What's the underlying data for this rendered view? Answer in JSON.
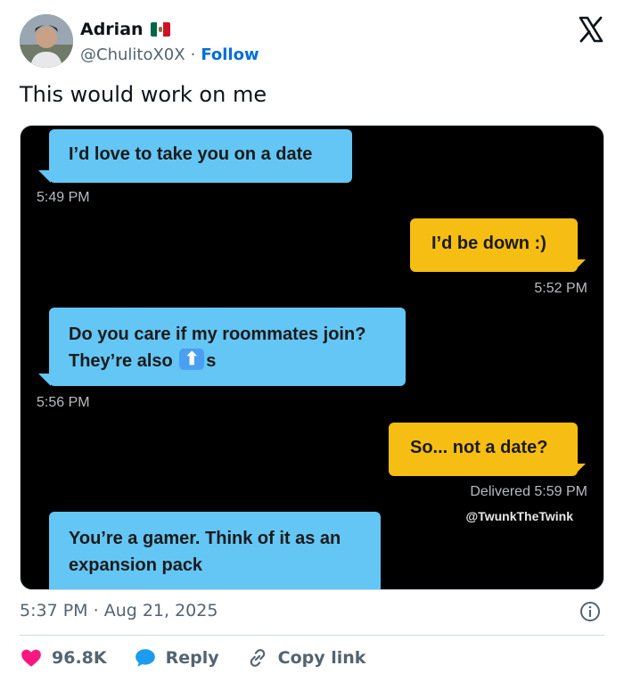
{
  "author": {
    "name": "Adrian",
    "handle": "@ChulitoX0X",
    "follow_label": "Follow",
    "separator": "·",
    "flag_colors": [
      "#006847",
      "#ffffff",
      "#ce1126"
    ]
  },
  "tweet": {
    "text": "This would work on me",
    "time": "5:37 PM",
    "date": "Aug 21, 2025",
    "meta_separator": "·"
  },
  "conversation": {
    "messages": [
      {
        "side": "in",
        "text": "I’d love to take you on a date",
        "stamp": "5:49 PM"
      },
      {
        "side": "out",
        "text": "I’d be down :)",
        "stamp": "5:52 PM"
      },
      {
        "side": "in",
        "line1": "Do you care if my roommates join?",
        "line2_prefix": "They’re also",
        "line2_suffix": "s",
        "stamp": "5:56 PM"
      },
      {
        "side": "out",
        "text": "So... not a date?",
        "stamp": "Delivered 5:59 PM"
      },
      {
        "side": "in",
        "line1": "You’re a gamer. Think of it as an",
        "line2": "expansion pack"
      }
    ],
    "credit": "@TwunkTheTwink",
    "colors": {
      "incoming": "#63c6f4",
      "outgoing": "#f6be12",
      "background": "#000000"
    }
  },
  "actions": {
    "likes": "96.8K",
    "reply_label": "Reply",
    "copy_label": "Copy link",
    "like_color": "#f91880",
    "reply_color": "#1d9bf0"
  }
}
